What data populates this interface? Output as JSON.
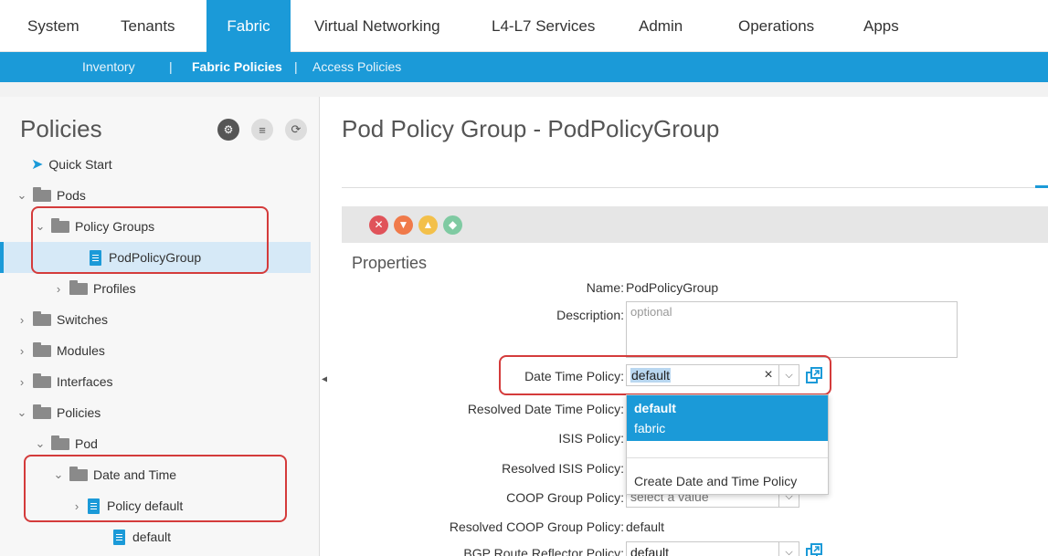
{
  "top_nav": {
    "tabs": [
      {
        "label": "System"
      },
      {
        "label": "Tenants"
      },
      {
        "label": "Fabric",
        "active": true
      },
      {
        "label": "Virtual Networking"
      },
      {
        "label": "L4-L7 Services"
      },
      {
        "label": "Admin"
      },
      {
        "label": "Operations"
      },
      {
        "label": "Apps"
      }
    ]
  },
  "sub_nav": {
    "items": [
      {
        "label": "Inventory"
      },
      {
        "label": "Fabric Policies",
        "active": true
      },
      {
        "label": "Access Policies"
      }
    ],
    "separator": "|"
  },
  "left_panel": {
    "title": "Policies",
    "tree": [
      {
        "label": "Quick Start",
        "icon": "quick-start-icon"
      },
      {
        "label": "Pods",
        "icon": "folder-icon",
        "expanded": true
      },
      {
        "label": "Policy Groups",
        "icon": "folder-icon",
        "expanded": true
      },
      {
        "label": "PodPolicyGroup",
        "icon": "document-icon",
        "selected": true
      },
      {
        "label": "Profiles",
        "icon": "folder-icon",
        "expanded": false
      },
      {
        "label": "Switches",
        "icon": "folder-icon",
        "expanded": false
      },
      {
        "label": "Modules",
        "icon": "folder-icon",
        "expanded": false
      },
      {
        "label": "Interfaces",
        "icon": "folder-icon",
        "expanded": false
      },
      {
        "label": "Policies",
        "icon": "folder-icon",
        "expanded": true
      },
      {
        "label": "Pod",
        "icon": "folder-icon",
        "expanded": true
      },
      {
        "label": "Date and Time",
        "icon": "folder-icon",
        "expanded": true
      },
      {
        "label": "Policy default",
        "icon": "document-icon",
        "expanded": false
      },
      {
        "label": "default",
        "icon": "document-icon"
      }
    ]
  },
  "main": {
    "title": "Pod Policy Group - PodPolicyGroup",
    "section_title": "Properties",
    "fields": {
      "name_label": "Name:",
      "name_value": "PodPolicyGroup",
      "description_label": "Description:",
      "description_placeholder": "optional",
      "date_time_label": "Date Time Policy:",
      "date_time_value": "default",
      "resolved_date_time_label": "Resolved Date Time Policy:",
      "isis_label": "ISIS Policy:",
      "resolved_isis_label": "Resolved ISIS Policy:",
      "coop_label": "COOP Group Policy:",
      "coop_placeholder": "select a value",
      "resolved_coop_label": "Resolved COOP Group Policy:",
      "resolved_coop_value": "default",
      "bgp_label": "BGP Route Reflector Policy:",
      "bgp_value": "default"
    },
    "dropdown": {
      "options": [
        "default",
        "fabric"
      ],
      "create_label": "Create Date and Time Policy"
    }
  },
  "colors": {
    "accent": "#1b9ad8",
    "highlight_box": "#d43b3b",
    "fault_critical": "#e0535a",
    "fault_major": "#f07a4a",
    "fault_minor": "#f3c04a",
    "fault_warning": "#7fcaa2"
  }
}
